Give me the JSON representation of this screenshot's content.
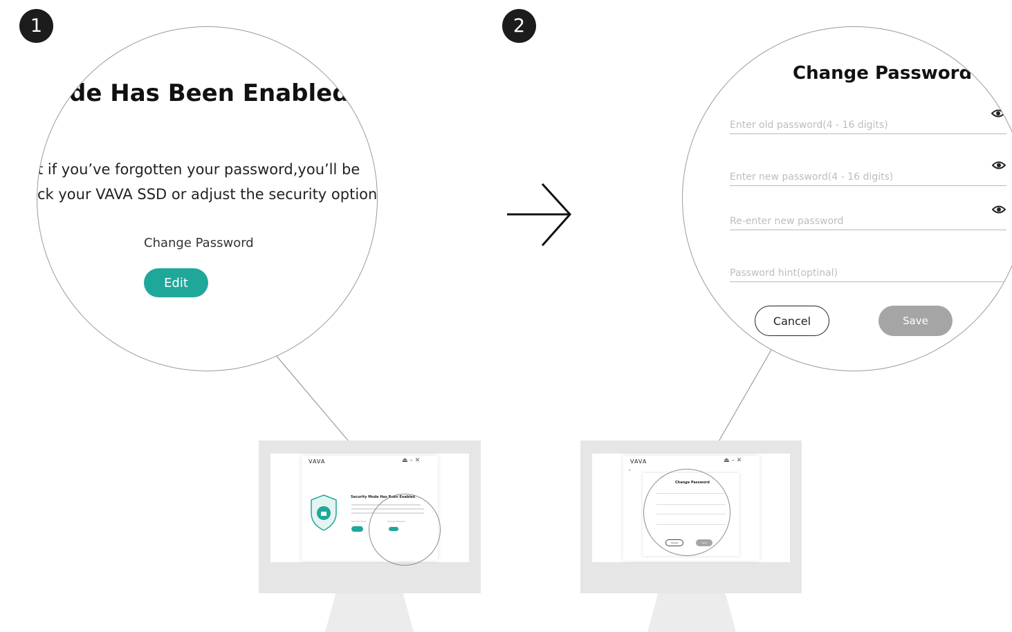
{
  "steps": [
    {
      "number": "1"
    },
    {
      "number": "2"
    }
  ],
  "zoom1": {
    "title_fragment": "de Has Been Enabled",
    "desc_line1": "t if you’ve forgotten your password,you’ll be",
    "desc_line2": "ck your VAVA SSD or adjust the security options.",
    "change_password_label": "Change Password",
    "edit_button": "Edit"
  },
  "zoom2": {
    "title": "Change Password",
    "old_password_placeholder": "Enter old password(4 - 16 digits)",
    "new_password_placeholder": "Enter new password(4 - 16 digits)",
    "reenter_placeholder": "Re-enter new password",
    "hint_placeholder": "Password hint(optinal)",
    "cancel_button": "Cancel",
    "save_button": "Save"
  },
  "monitor1": {
    "logo": "VAVA",
    "heading": "Security Mode Has Been Enabled",
    "security_mode_label": "Security Mode",
    "change_password_label": "Change Password"
  },
  "monitor2": {
    "logo": "VAVA",
    "dialog_title": "Change Password",
    "cancel_button": "Cancel",
    "save_button": "Save"
  },
  "icons": {
    "arrow": "arrow-right-icon",
    "eye": "eye-icon",
    "shield": "shield-lock-icon"
  },
  "colors": {
    "accent": "#1fa89a",
    "badge": "#1c1c1c",
    "save_disabled": "#a5a5a5"
  }
}
